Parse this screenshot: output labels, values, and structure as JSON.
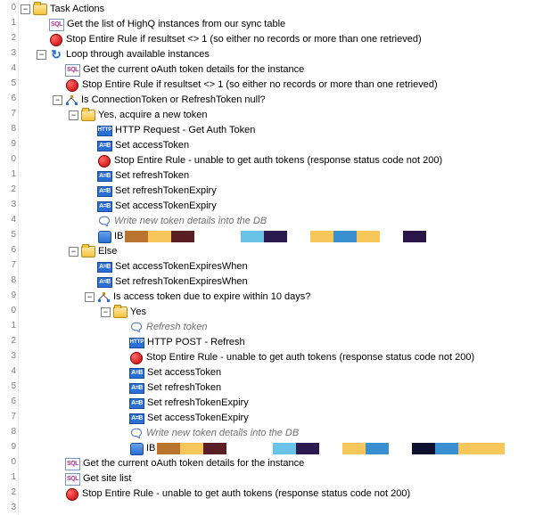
{
  "root": {
    "label": "Task Actions"
  },
  "lines": {
    "l1": "Get the list of HighQ instances from our sync table",
    "l2": "Stop Entire Rule if resultset <> 1 (so either no records or more than one retrieved)",
    "l3": "Loop through available instances",
    "l4": "Get the current oAuth token details for the instance",
    "l5": "Stop Entire Rule if resultset <> 1 (so either no records or more than one retrieved)",
    "l6": "Is ConnectionToken or RefreshToken null?",
    "l7": "Yes, acquire a new token",
    "l8": "HTTP Request - Get Auth Token",
    "l9": "Set accessToken",
    "l10": "Stop Entire Rule - unable to get auth tokens (response status code not 200)",
    "l11": "Set refreshToken",
    "l12": "Set refreshTokenExpiry",
    "l13": "Set accessTokenExpiry",
    "l14": "Write new token details into the DB",
    "l15": "IB",
    "l16": "Else",
    "l17": "Set accessTokenExpiresWhen",
    "l18": "Set refreshTokenExpiresWhen",
    "l19": "Is access token due to expire within 10 days?",
    "l20": "Yes",
    "l21": "Refresh token",
    "l22": "HTTP POST - Refresh",
    "l23": "Stop Entire Rule - unable to get auth tokens (response status code not 200)",
    "l24": "Set accessToken",
    "l25": "Set refreshToken",
    "l26": "Set refreshTokenExpiry",
    "l27": "Set accessTokenExpiry",
    "l28": "Write new token details into the DB",
    "l29": "IB",
    "l30": "Get the current oAuth token details for the instance",
    "l31": "Get site list",
    "l32": "Stop Entire Rule - unable to get auth tokens (response status code not 200)"
  },
  "swatches_a": [
    "#b9752f",
    "#f7c75c",
    "#5a1f25",
    "#ffffff",
    "#ffffff",
    "#69c3e6",
    "#2a1a4d",
    "#ffffff",
    "#f7c75c",
    "#3a8fd1",
    "#f7c75c",
    "#ffffff",
    "#2a1548"
  ],
  "swatches_b": [
    "#b9752f",
    "#f7c75c",
    "#5a1f25",
    "#ffffff",
    "#ffffff",
    "#69c3e6",
    "#2a1a4d",
    "#ffffff",
    "#f7c75c",
    "#3a8fd1",
    "#ffffff",
    "#0f0f2f",
    "#3a8fd1",
    "#f7c75c",
    "#f7c75c"
  ],
  "gutter_digits": [
    "0",
    "1",
    "2",
    "3",
    "4",
    "5",
    "6",
    "7",
    "8",
    "9",
    "0",
    "1",
    "2",
    "3",
    "4",
    "5",
    "6",
    "7",
    "8",
    "9",
    "0",
    "1",
    "2",
    "3",
    "4",
    "5",
    "6",
    "7",
    "8",
    "9",
    "0",
    "1",
    "2",
    "3"
  ]
}
